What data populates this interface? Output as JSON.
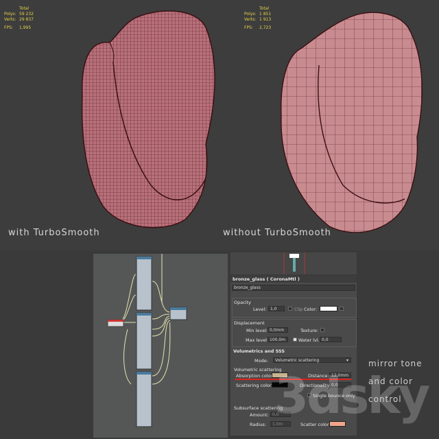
{
  "stats_left": {
    "header": "Total",
    "polys_label": "Polys:",
    "polys": "59 232",
    "verts_label": "Verts:",
    "verts": "29 837",
    "fps_label": "FPS:",
    "fps": "1,995"
  },
  "stats_right": {
    "header": "Total",
    "polys_label": "Polys:",
    "polys": "1 851",
    "verts_label": "Verts:",
    "verts": "1 913",
    "fps_label": "FPS:",
    "fps": "2,723"
  },
  "captions": {
    "left": "with TurboSmooth",
    "right": "without TurboSmooth"
  },
  "material": {
    "header": "bronze_glass  ( CoronaMtl )",
    "name": "bronze_glass",
    "opacity": {
      "title": "Opacity",
      "level_label": "Level:",
      "level": "1,0",
      "clip_label": "Clip",
      "color_label": "Color:"
    },
    "displacement": {
      "title": "Displacement",
      "min_label": "Min level:",
      "min": "0,0mm",
      "texture_label": "Texture:",
      "max_label": "Max level:",
      "max": "100,0m",
      "water_label": "Water lvl.:",
      "water": "0,0"
    },
    "volumetrics": {
      "title": "Volumetrics and SSS",
      "mode_label": "Mode:",
      "mode": "Volumetric scattering",
      "vs_title": "Volumetric scattering",
      "absorption_label": "Absorption color:",
      "distance_label": "Distance:",
      "distance": "12,0mm",
      "scattering_label": "Scattering color:",
      "directionality_label": "Directionality:",
      "directionality": "0,0",
      "single_bounce_label": "Single bounce only",
      "sss_title": "Subsurface scattering",
      "amount_label": "Amount:",
      "amount": "0,0",
      "radius_label": "Radius:",
      "radius": "1,0m",
      "scatter_label": "Scatter color:"
    }
  },
  "side_text": [
    "mirror tone",
    "and color",
    "control"
  ],
  "watermark": "3dsky",
  "colors": {
    "stats": "#e7d34a",
    "mesh_fill": "#b8707a",
    "mesh_fill_right": "#c88b8f",
    "absorption": "#c9b38f",
    "scattering": "#050505",
    "scatter_sss": "#f0a58a",
    "highlight": "#e0201c"
  }
}
